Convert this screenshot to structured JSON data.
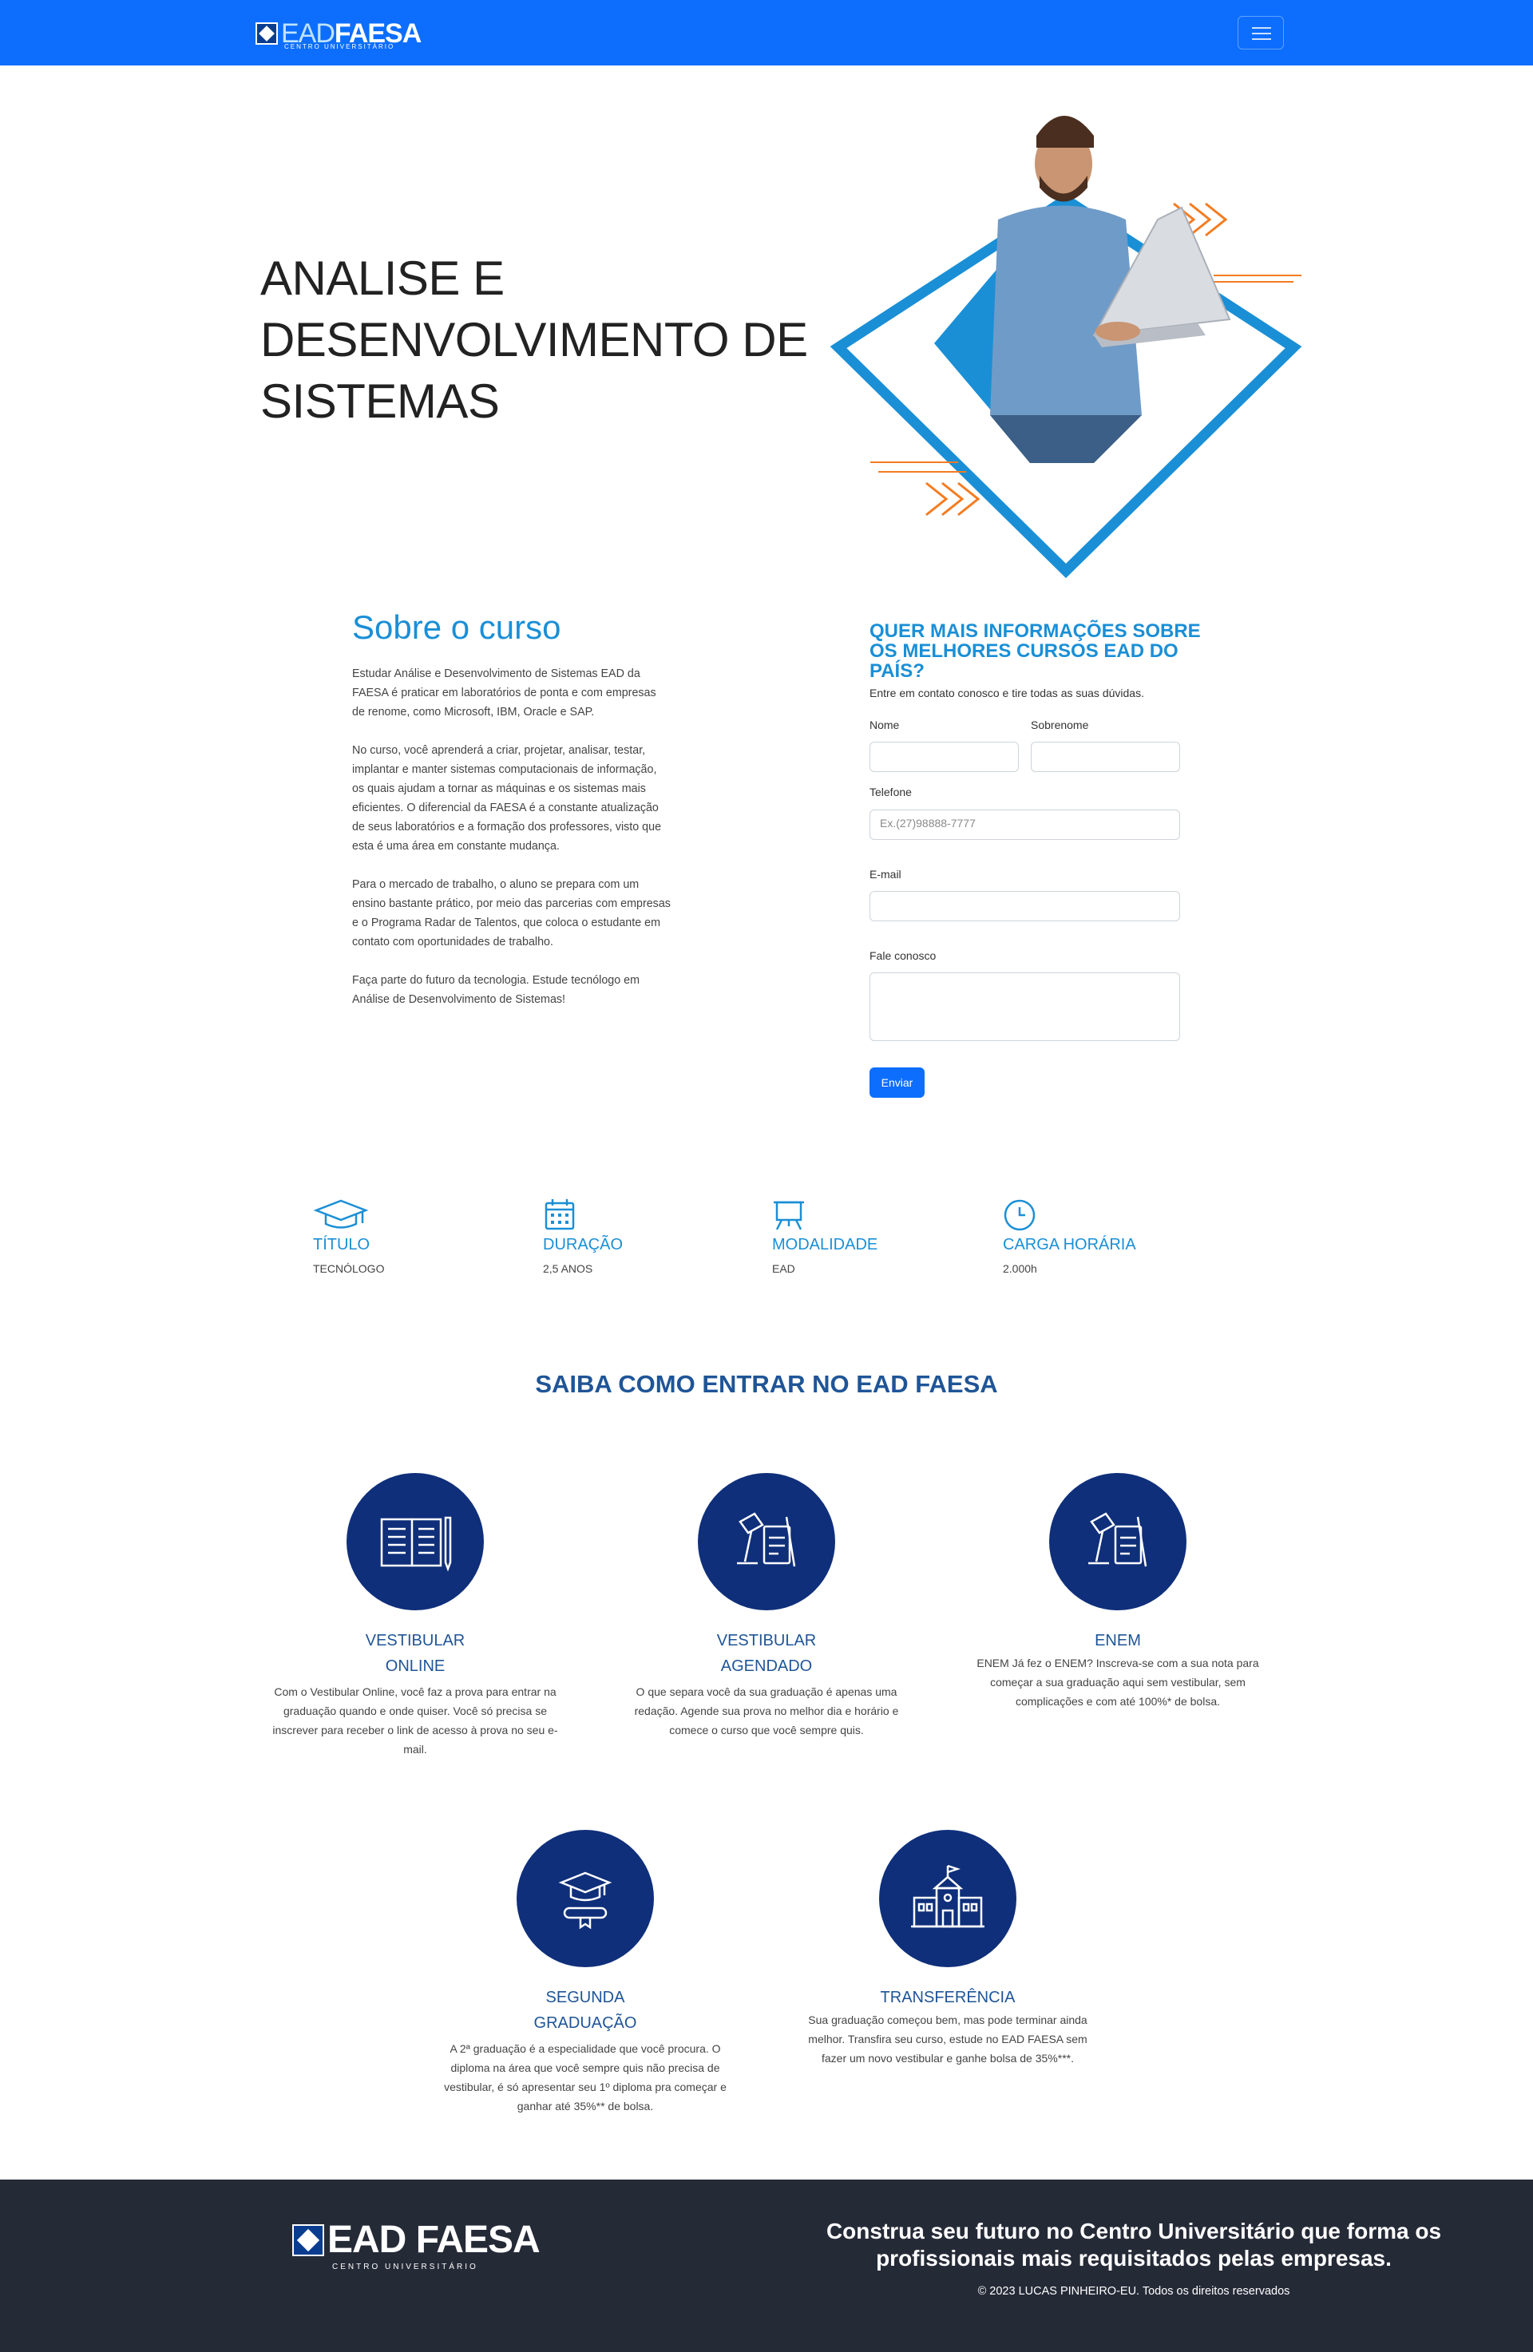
{
  "navbar": {
    "logo_ead": "EAD",
    "logo_faesa": "FAESA",
    "logo_subtitle": "CENTRO UNIVERSITÁRIO",
    "toggler_icon": "hamburger-icon",
    "color": "#0d6efd"
  },
  "hero": {
    "title": "ANALISE E DESENVOLVIMENTO DE SISTEMAS",
    "accent_color": "#1a8fd6",
    "decor_color": "#f47c20"
  },
  "about": {
    "title": "Sobre o curso",
    "paragraphs": [
      "Estudar Análise e Desenvolvimento de Sistemas EAD da FAESA é praticar em laboratórios de ponta e com empresas de renome, como Microsoft, IBM, Oracle e SAP.",
      "No curso, você aprenderá a criar, projetar, analisar, testar, implantar e manter sistemas computacionais de informação, os quais ajudam a tornar as máquinas e os sistemas mais eficientes. O diferencial da FAESA é a constante atualização de seus laboratórios e a formação dos professores, visto que esta é uma área em constante mudança.",
      "Para o mercado de trabalho, o aluno se prepara com um ensino bastante prático, por meio das parcerias com empresas e o Programa Radar de Talentos, que coloca o estudante em contato com oportunidades de trabalho.",
      "Faça parte do futuro da tecnologia. Estude tecnólogo em Análise de Desenvolvimento de Sistemas!"
    ]
  },
  "form": {
    "title": "QUER MAIS INFORMAÇÕES SOBRE OS MELHORES CURSOS EAD DO PAÍS?",
    "subtitle": "Entre em contato conosco e tire todas as suas dúvidas.",
    "nome_label": "Nome",
    "nome_value": "",
    "sobrenome_label": "Sobrenome",
    "sobrenome_value": "",
    "telefone_label": "Telefone",
    "telefone_placeholder": "Ex.(27)98888-7777",
    "email_label": "E-mail",
    "email_value": "",
    "mensagem_label": "Fale conosco",
    "mensagem_value": "",
    "submit_label": "Enviar"
  },
  "info": [
    {
      "icon": "graduation-cap-icon",
      "title": "TÍTULO",
      "value": "TECNÓLOGO"
    },
    {
      "icon": "calendar-icon",
      "title": "DURAÇÃO",
      "value": "2,5 ANOS"
    },
    {
      "icon": "presentation-board-icon",
      "title": "MODALIDADE",
      "value": "EAD"
    },
    {
      "icon": "clock-icon",
      "title": "CARGA HORÁRIA",
      "value": "2.000h"
    }
  ],
  "saiba": {
    "title": "SAIBA COMO ENTRAR NO EAD FAESA",
    "circle_color": "#0f2f7a",
    "cards": [
      {
        "icon": "open-book-icon",
        "title_line1": "VESTIBULAR",
        "title_line2": "ONLINE",
        "text": "Com o Vestibular Online, você faz a prova para entrar na graduação quando e onde quiser. Você só precisa se inscrever para receber o link de acesso à prova no seu e-mail."
      },
      {
        "icon": "desk-lamp-exam-icon",
        "title_line1": "VESTIBULAR",
        "title_line2": "AGENDADO",
        "text": "O que separa você da sua graduação é apenas uma redação. Agende sua prova no melhor dia e horário e comece o curso que você sempre quis."
      },
      {
        "icon": "desk-lamp-exam-icon",
        "title_line1": "ENEM",
        "title_line2": "",
        "text": "ENEM Já fez o ENEM? Inscreva-se com a sua nota para começar a sua graduação aqui sem vestibular, sem complicações e com até 100%* de bolsa."
      },
      {
        "icon": "graduation-diploma-icon",
        "title_line1": "SEGUNDA",
        "title_line2": "GRADUAÇÃO",
        "text": "A 2ª graduação é a especialidade que você procura. O diploma na área que você sempre quis não precisa de vestibular, é só apresentar seu 1º diploma pra começar e ganhar até 35%** de bolsa."
      },
      {
        "icon": "school-building-icon",
        "title_line1": "TRANSFERÊNCIA",
        "title_line2": "",
        "text": "Sua graduação começou bem, mas pode terminar ainda melhor. Transfira seu curso, estude no EAD FAESA sem fazer um novo vestibular e ganhe bolsa de 35%***."
      }
    ]
  },
  "footer": {
    "logo_ead": "EAD",
    "logo_faesa": "FAESA",
    "logo_subtitle": "CENTRO UNIVERSITÁRIO",
    "message": "Construa seu futuro no Centro Universitário que forma os profissionais mais requisitados pelas empresas.",
    "copyright": "© 2023 LUCAS PINHEIRO-EU. Todos os direitos reservados",
    "color": "#252a37"
  }
}
